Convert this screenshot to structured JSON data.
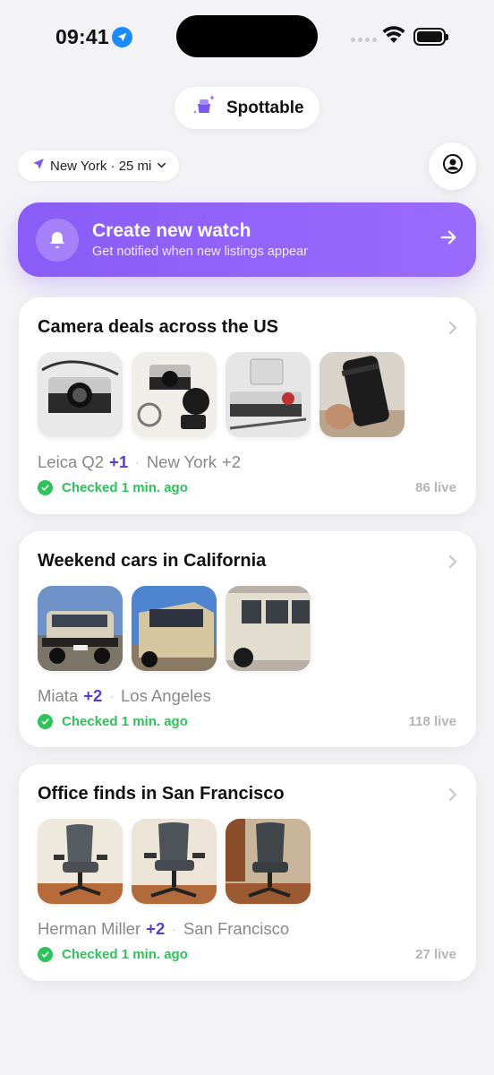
{
  "status": {
    "time": "09:41"
  },
  "brand": {
    "name": "Spottable"
  },
  "location": {
    "label": "New York · 25 mi"
  },
  "cta": {
    "title": "Create new watch",
    "subtitle": "Get notified when new listings appear"
  },
  "watches": [
    {
      "title": "Camera deals across the US",
      "item": "Leica Q2",
      "item_more": "+1",
      "place": "New York",
      "place_more": "+2",
      "status": "Checked 1 min. ago",
      "live": "86 live",
      "thumbs": [
        "camera-icon",
        "camera-icon",
        "camera-icon",
        "lens-icon"
      ]
    },
    {
      "title": "Weekend cars in California",
      "item": "Miata",
      "item_more": "+2",
      "place": "Los Angeles",
      "place_more": "",
      "status": "Checked 1 min. ago",
      "live": "118 live",
      "thumbs": [
        "car-icon",
        "car-icon",
        "car-icon"
      ]
    },
    {
      "title": "Office finds in San Francisco",
      "item": "Herman Miller",
      "item_more": "+2",
      "place": "San Francisco",
      "place_more": "",
      "status": "Checked 1 min. ago",
      "live": "27 live",
      "thumbs": [
        "chair-icon",
        "chair-icon",
        "chair-icon"
      ]
    }
  ],
  "colors": {
    "accent": "#8a5cf8",
    "plus": "#5a3bd6",
    "success": "#2ec25a"
  }
}
